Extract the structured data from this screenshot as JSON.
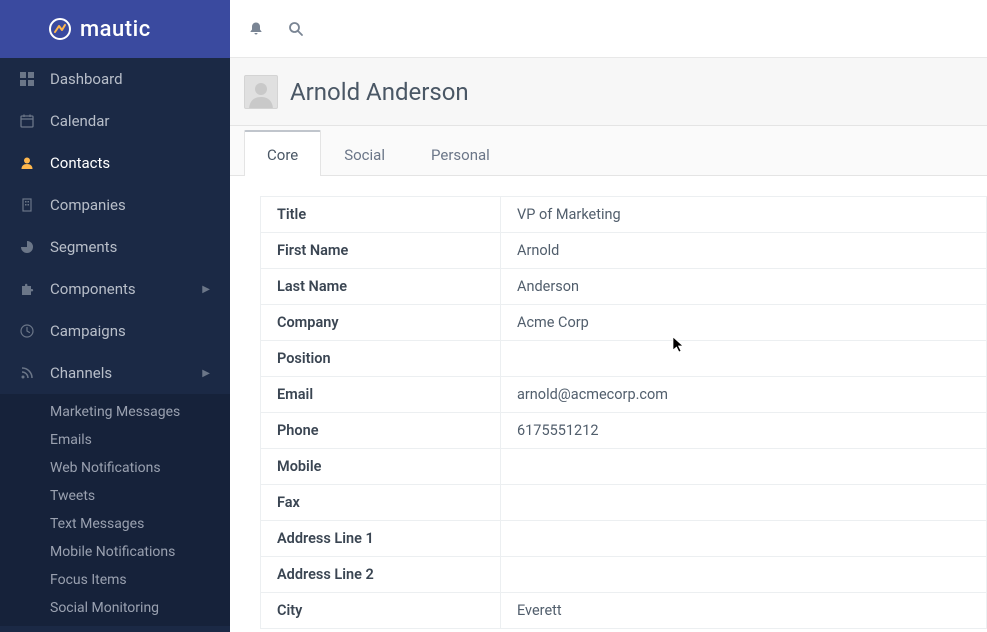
{
  "brand": {
    "name": "mautic"
  },
  "sidebar": {
    "items": [
      {
        "label": "Dashboard",
        "icon": "grid"
      },
      {
        "label": "Calendar",
        "icon": "calendar"
      },
      {
        "label": "Contacts",
        "icon": "user",
        "active": true
      },
      {
        "label": "Companies",
        "icon": "building"
      },
      {
        "label": "Segments",
        "icon": "piechart"
      },
      {
        "label": "Components",
        "icon": "puzzle",
        "caret": true
      },
      {
        "label": "Campaigns",
        "icon": "clock"
      },
      {
        "label": "Channels",
        "icon": "rss",
        "caret": true,
        "expanded": true
      }
    ],
    "channels_sub": [
      {
        "label": "Marketing Messages"
      },
      {
        "label": "Emails"
      },
      {
        "label": "Web Notifications"
      },
      {
        "label": "Tweets"
      },
      {
        "label": "Text Messages"
      },
      {
        "label": "Mobile Notifications"
      },
      {
        "label": "Focus Items"
      },
      {
        "label": "Social Monitoring"
      }
    ]
  },
  "contact": {
    "display_name": "Arnold Anderson"
  },
  "tabs": [
    {
      "label": "Core",
      "active": true
    },
    {
      "label": "Social"
    },
    {
      "label": "Personal"
    }
  ],
  "details": [
    {
      "k": "Title",
      "v": "VP of Marketing"
    },
    {
      "k": "First Name",
      "v": "Arnold"
    },
    {
      "k": "Last Name",
      "v": "Anderson"
    },
    {
      "k": "Company",
      "v": "Acme Corp"
    },
    {
      "k": "Position",
      "v": ""
    },
    {
      "k": "Email",
      "v": "arnold@acmecorp.com"
    },
    {
      "k": "Phone",
      "v": "6175551212"
    },
    {
      "k": "Mobile",
      "v": ""
    },
    {
      "k": "Fax",
      "v": ""
    },
    {
      "k": "Address Line 1",
      "v": ""
    },
    {
      "k": "Address Line 2",
      "v": ""
    },
    {
      "k": "City",
      "v": "Everett"
    }
  ]
}
